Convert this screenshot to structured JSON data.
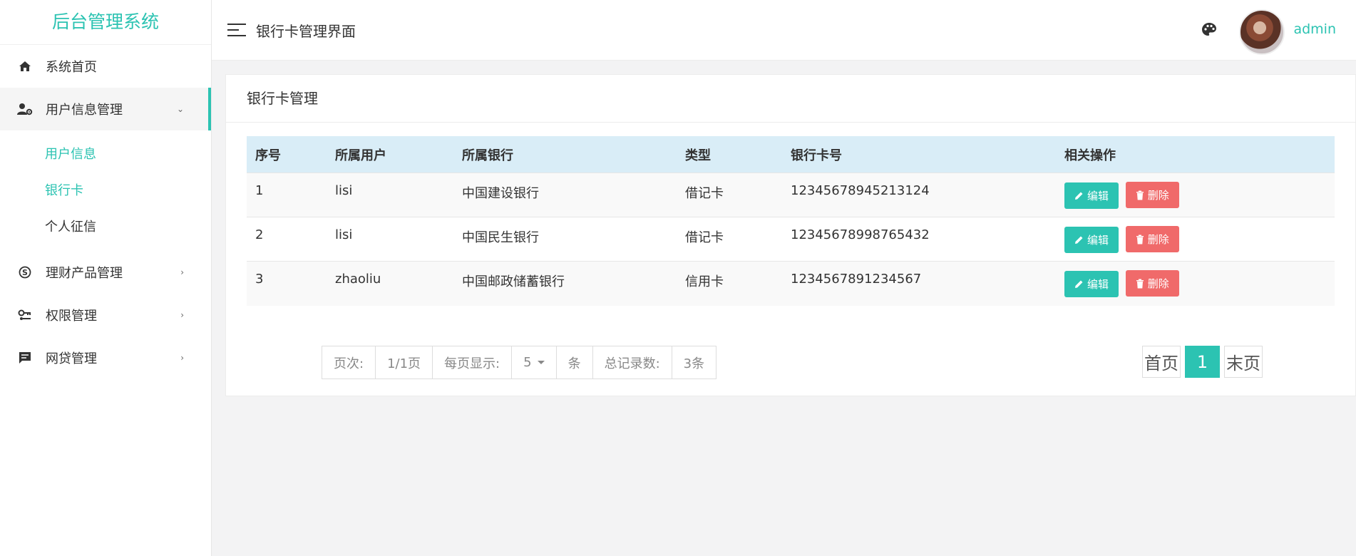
{
  "sidebar": {
    "logo": "后台管理系统",
    "menu": [
      {
        "label": "系统首页",
        "icon": "home-icon"
      },
      {
        "label": "用户信息管理",
        "icon": "user-settings-icon"
      },
      {
        "label": "理财产品管理",
        "icon": "skype-icon"
      },
      {
        "label": "权限管理",
        "icon": "key-icon"
      },
      {
        "label": "网贷管理",
        "icon": "message-icon"
      }
    ],
    "submenu": [
      "用户信息",
      "银行卡",
      "个人征信"
    ]
  },
  "header": {
    "title": "银行卡管理界面",
    "user": "admin"
  },
  "panel": {
    "title": "银行卡管理",
    "columns": [
      "序号",
      "所属用户",
      "所属银行",
      "类型",
      "银行卡号",
      "相关操作"
    ],
    "rows": [
      {
        "id": "1",
        "user": "lisi",
        "bank": "中国建设银行",
        "type": "借记卡",
        "card": "12345678945213124"
      },
      {
        "id": "2",
        "user": "lisi",
        "bank": "中国民生银行",
        "type": "借记卡",
        "card": "12345678998765432"
      },
      {
        "id": "3",
        "user": "zhaoliu",
        "bank": "中国邮政储蓄银行",
        "type": "信用卡",
        "card": "1234567891234567"
      }
    ],
    "edit_label": "编辑",
    "delete_label": "删除"
  },
  "pager": {
    "page_label": "页次:",
    "page_value": "1/1页",
    "per_page_label": "每页显示:",
    "per_page_value": "5",
    "unit": "条",
    "total_label": "总记录数:",
    "total_value": "3条",
    "first": "首页",
    "current": "1",
    "last": "末页"
  },
  "colors": {
    "accent": "#2cc3b2",
    "danger": "#f06a6a",
    "table_header": "#d9edf7"
  }
}
